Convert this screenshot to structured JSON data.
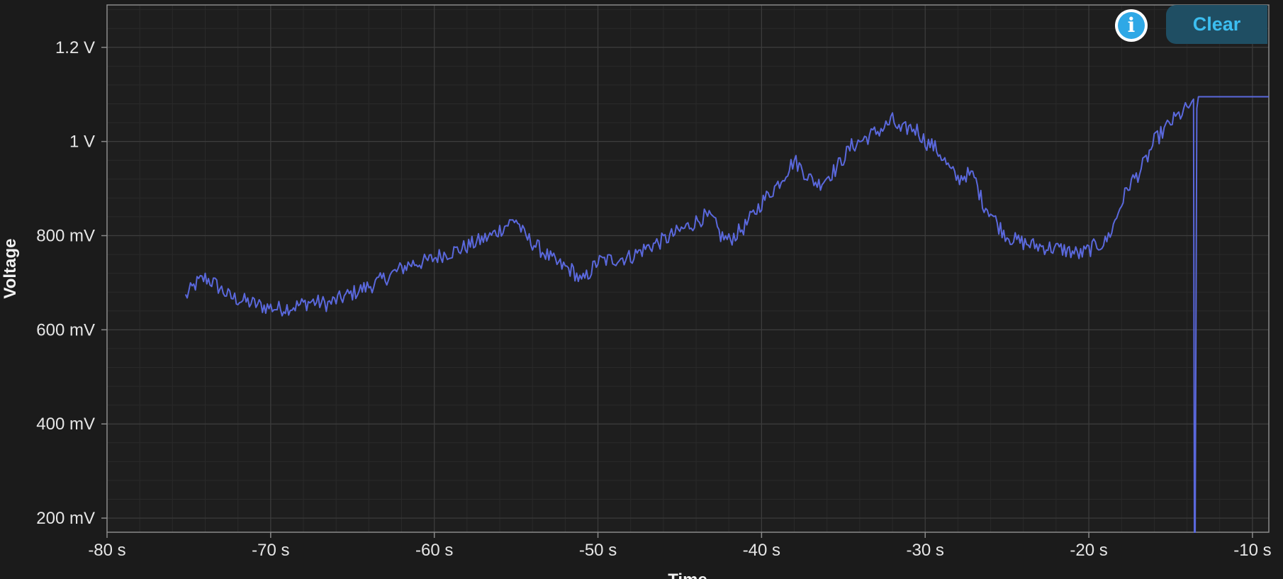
{
  "toolbar": {
    "clear_label": "Clear",
    "info_icon_glyph": "i"
  },
  "colors": {
    "background": "#1b1b1b",
    "series": "#5a68dc",
    "grid": "#3a3a3a",
    "accent": "#3cbef0"
  },
  "chart_data": {
    "type": "line",
    "title": "",
    "xlabel": "Time",
    "ylabel": "Voltage",
    "xlim": [
      -80,
      -9
    ],
    "ylim": [
      0.17,
      1.29
    ],
    "x_ticks": [
      -80,
      -70,
      -60,
      -50,
      -40,
      -30,
      -20,
      -10
    ],
    "x_tick_labels": [
      "-80 s",
      "-70 s",
      "-60 s",
      "-50 s",
      "-40 s",
      "-30 s",
      "-20 s",
      "-10 s"
    ],
    "y_ticks": [
      0.2,
      0.4,
      0.6,
      0.8,
      1.0,
      1.2
    ],
    "y_tick_labels": [
      "200 mV",
      "400 mV",
      "600 mV",
      "800 mV",
      "1 V",
      "1.2 V"
    ],
    "grid": true,
    "series": [
      {
        "color": "#5a68dc",
        "x": [
          -75.2,
          -74.5,
          -74,
          -73.5,
          -72.5,
          -71.5,
          -70.5,
          -69.5,
          -68.5,
          -67.5,
          -66.5,
          -65.5,
          -64.5,
          -63.5,
          -62.5,
          -61.5,
          -60.5,
          -59.5,
          -58.5,
          -57.5,
          -56.5,
          -55.5,
          -55,
          -54.5,
          -53.5,
          -52.5,
          -51.5,
          -51,
          -50,
          -49,
          -48,
          -47,
          -46,
          -45,
          -44,
          -43.5,
          -43,
          -42.5,
          -42,
          -41,
          -40,
          -39,
          -38,
          -37.5,
          -37,
          -36.5,
          -35.5,
          -34.5,
          -33.5,
          -32.5,
          -32,
          -31.5,
          -31,
          -30.5,
          -30,
          -29.5,
          -29,
          -28.5,
          -28,
          -27.5,
          -27,
          -26.5,
          -26,
          -25.5,
          -25,
          -24.5,
          -23.5,
          -22.5,
          -21.5,
          -20.5,
          -19.5,
          -19,
          -18.5,
          -18,
          -17.5,
          -17,
          -16.5,
          -16,
          -15,
          -14,
          -13.6,
          -13.55,
          -13.5,
          -13.4,
          -13.3,
          -12,
          -10.5,
          -9
        ],
        "y": [
          0.67,
          0.7,
          0.71,
          0.7,
          0.67,
          0.66,
          0.65,
          0.645,
          0.65,
          0.66,
          0.655,
          0.67,
          0.685,
          0.7,
          0.72,
          0.74,
          0.745,
          0.76,
          0.77,
          0.785,
          0.8,
          0.825,
          0.835,
          0.8,
          0.77,
          0.74,
          0.725,
          0.7,
          0.745,
          0.75,
          0.755,
          0.775,
          0.79,
          0.81,
          0.83,
          0.84,
          0.835,
          0.8,
          0.79,
          0.82,
          0.87,
          0.91,
          0.96,
          0.94,
          0.92,
          0.91,
          0.94,
          0.99,
          1.01,
          1.03,
          1.045,
          1.02,
          1.03,
          1.025,
          1.0,
          0.99,
          0.97,
          0.94,
          0.92,
          0.93,
          0.925,
          0.87,
          0.85,
          0.82,
          0.8,
          0.79,
          0.78,
          0.775,
          0.77,
          0.76,
          0.78,
          0.785,
          0.82,
          0.87,
          0.91,
          0.93,
          0.96,
          1.0,
          1.04,
          1.07,
          1.09,
          0.17,
          0.17,
          1.07,
          1.095,
          1.095,
          1.095,
          1.095
        ]
      }
    ]
  }
}
